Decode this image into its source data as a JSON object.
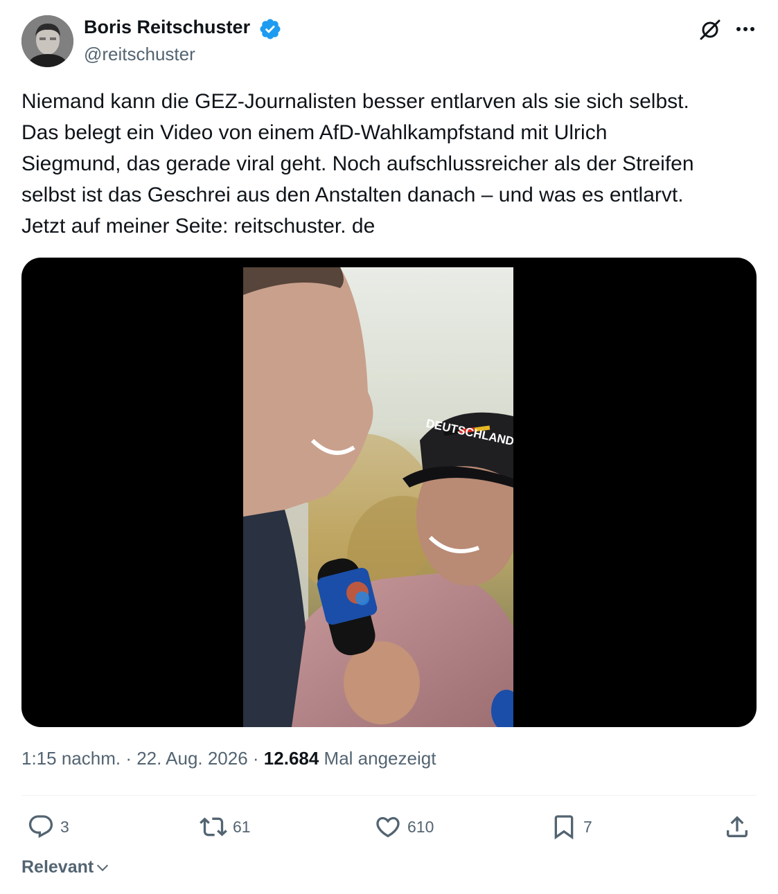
{
  "author": {
    "name": "Boris Reitschuster",
    "handle": "@reitschuster",
    "verified": true
  },
  "icons": {
    "verified": "verified-badge-icon",
    "grok": "grok-icon",
    "more": "more-icon",
    "reply": "reply-icon",
    "retweet": "retweet-icon",
    "like": "heart-icon",
    "bookmark": "bookmark-icon",
    "share": "share-icon",
    "sort": "chevron-down-icon"
  },
  "tweet": {
    "text": "Niemand kann die GEZ-Journalisten besser entlarven als sie sich selbst.\nDas belegt ein Video von einem AfD-Wahlkampfstand mit Ulrich\nSiegmund, das gerade viral geht. Noch aufschlussreicher als der Streifen\nselbst ist das Geschrei aus den Anstalten danach – und was es entlarvt.\nJetzt auf meiner Seite: reitschuster. de"
  },
  "media": {
    "cap_text": "DEUTSCHLAND"
  },
  "meta": {
    "time": "1:15 nachm.",
    "sep1": " · ",
    "date": "22. Aug. 2026",
    "sep2": " · ",
    "views": "12.684",
    "views_label": " Mal angezeigt"
  },
  "actions": {
    "replies": "3",
    "retweets": "61",
    "likes": "610",
    "bookmarks": "7"
  },
  "sort": {
    "label": "Relevant"
  },
  "colors": {
    "text": "#0f1419",
    "muted": "#536471",
    "verified": "#1d9bf0",
    "divider": "#eff3f4"
  }
}
